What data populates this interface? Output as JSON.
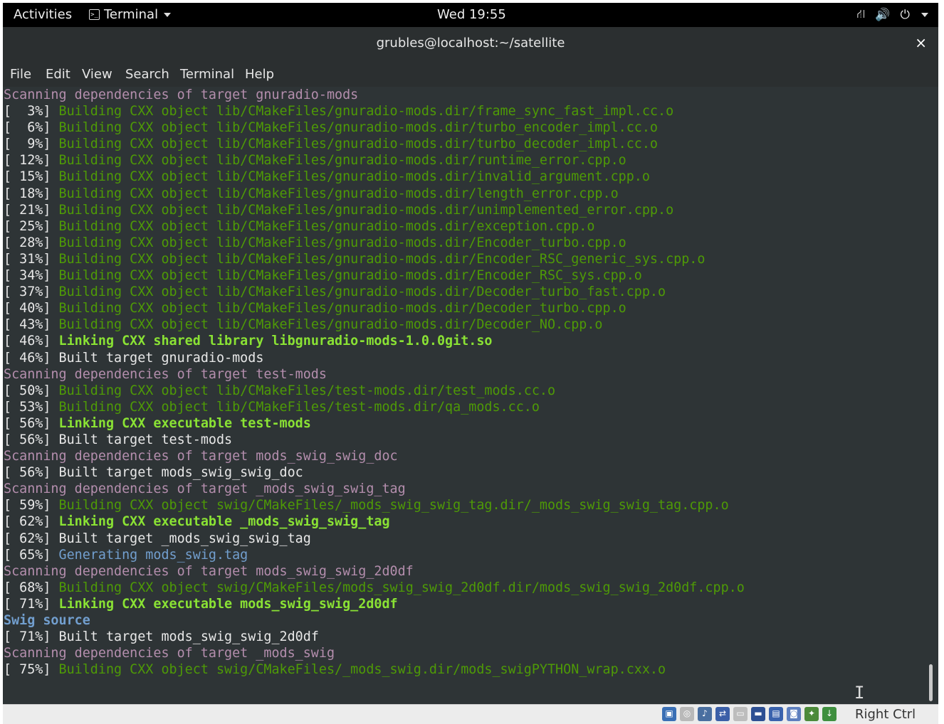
{
  "topbar": {
    "activities": "Activities",
    "app_name": "Terminal",
    "clock": "Wed 19:55"
  },
  "window": {
    "title": "grubles@localhost:~/satellite",
    "close": "×"
  },
  "menu": [
    "File",
    "Edit",
    "View",
    "Search",
    "Terminal",
    "Help"
  ],
  "terminal": {
    "lines": [
      {
        "type": "scan",
        "text": "Scanning dependencies of target gnuradio-mods"
      },
      {
        "type": "build",
        "pct": "[  3%] ",
        "text": "Building CXX object lib/CMakeFiles/gnuradio-mods.dir/frame_sync_fast_impl.cc.o"
      },
      {
        "type": "build",
        "pct": "[  6%] ",
        "text": "Building CXX object lib/CMakeFiles/gnuradio-mods.dir/turbo_encoder_impl.cc.o"
      },
      {
        "type": "build",
        "pct": "[  9%] ",
        "text": "Building CXX object lib/CMakeFiles/gnuradio-mods.dir/turbo_decoder_impl.cc.o"
      },
      {
        "type": "build",
        "pct": "[ 12%] ",
        "text": "Building CXX object lib/CMakeFiles/gnuradio-mods.dir/runtime_error.cpp.o"
      },
      {
        "type": "build",
        "pct": "[ 15%] ",
        "text": "Building CXX object lib/CMakeFiles/gnuradio-mods.dir/invalid_argument.cpp.o"
      },
      {
        "type": "build",
        "pct": "[ 18%] ",
        "text": "Building CXX object lib/CMakeFiles/gnuradio-mods.dir/length_error.cpp.o"
      },
      {
        "type": "build",
        "pct": "[ 21%] ",
        "text": "Building CXX object lib/CMakeFiles/gnuradio-mods.dir/unimplemented_error.cpp.o"
      },
      {
        "type": "build",
        "pct": "[ 25%] ",
        "text": "Building CXX object lib/CMakeFiles/gnuradio-mods.dir/exception.cpp.o"
      },
      {
        "type": "build",
        "pct": "[ 28%] ",
        "text": "Building CXX object lib/CMakeFiles/gnuradio-mods.dir/Encoder_turbo.cpp.o"
      },
      {
        "type": "build",
        "pct": "[ 31%] ",
        "text": "Building CXX object lib/CMakeFiles/gnuradio-mods.dir/Encoder_RSC_generic_sys.cpp.o"
      },
      {
        "type": "build",
        "pct": "[ 34%] ",
        "text": "Building CXX object lib/CMakeFiles/gnuradio-mods.dir/Encoder_RSC_sys.cpp.o"
      },
      {
        "type": "build",
        "pct": "[ 37%] ",
        "text": "Building CXX object lib/CMakeFiles/gnuradio-mods.dir/Decoder_turbo_fast.cpp.o"
      },
      {
        "type": "build",
        "pct": "[ 40%] ",
        "text": "Building CXX object lib/CMakeFiles/gnuradio-mods.dir/Decoder_turbo.cpp.o"
      },
      {
        "type": "build",
        "pct": "[ 43%] ",
        "text": "Building CXX object lib/CMakeFiles/gnuradio-mods.dir/Decoder_NO.cpp.o"
      },
      {
        "type": "link",
        "pct": "[ 46%] ",
        "text": "Linking CXX shared library libgnuradio-mods-1.0.0git.so"
      },
      {
        "type": "built",
        "pct": "[ 46%] ",
        "text": "Built target gnuradio-mods"
      },
      {
        "type": "scan",
        "text": "Scanning dependencies of target test-mods"
      },
      {
        "type": "build",
        "pct": "[ 50%] ",
        "text": "Building CXX object lib/CMakeFiles/test-mods.dir/test_mods.cc.o"
      },
      {
        "type": "build",
        "pct": "[ 53%] ",
        "text": "Building CXX object lib/CMakeFiles/test-mods.dir/qa_mods.cc.o"
      },
      {
        "type": "link",
        "pct": "[ 56%] ",
        "text": "Linking CXX executable test-mods"
      },
      {
        "type": "built",
        "pct": "[ 56%] ",
        "text": "Built target test-mods"
      },
      {
        "type": "scan",
        "text": "Scanning dependencies of target mods_swig_swig_doc"
      },
      {
        "type": "built",
        "pct": "[ 56%] ",
        "text": "Built target mods_swig_swig_doc"
      },
      {
        "type": "scan",
        "text": "Scanning dependencies of target _mods_swig_swig_tag"
      },
      {
        "type": "build",
        "pct": "[ 59%] ",
        "text": "Building CXX object swig/CMakeFiles/_mods_swig_swig_tag.dir/_mods_swig_swig_tag.cpp.o"
      },
      {
        "type": "link",
        "pct": "[ 62%] ",
        "text": "Linking CXX executable _mods_swig_swig_tag"
      },
      {
        "type": "built",
        "pct": "[ 62%] ",
        "text": "Built target _mods_swig_swig_tag"
      },
      {
        "type": "gen",
        "pct": "[ 65%] ",
        "text": "Generating mods_swig.tag"
      },
      {
        "type": "scan",
        "text": "Scanning dependencies of target mods_swig_swig_2d0df"
      },
      {
        "type": "build",
        "pct": "[ 68%] ",
        "text": "Building CXX object swig/CMakeFiles/mods_swig_swig_2d0df.dir/mods_swig_swig_2d0df.cpp.o"
      },
      {
        "type": "link",
        "pct": "[ 71%] ",
        "text": "Linking CXX executable mods_swig_swig_2d0df"
      },
      {
        "type": "swig",
        "text": "Swig source"
      },
      {
        "type": "built",
        "pct": "[ 71%] ",
        "text": "Built target mods_swig_swig_2d0df"
      },
      {
        "type": "scan",
        "text": "Scanning dependencies of target _mods_swig"
      },
      {
        "type": "build",
        "pct": "[ 75%] ",
        "text": "Building CXX object swig/CMakeFiles/_mods_swig.dir/mods_swigPYTHON_wrap.cxx.o"
      }
    ]
  },
  "statusbar": {
    "host_key": "Right Ctrl",
    "icons": [
      {
        "name": "hard-disk-icon",
        "color": "#3a6fb5",
        "glyph": "▣"
      },
      {
        "name": "optical-drive-icon",
        "color": "#b9b9b9",
        "glyph": "◎"
      },
      {
        "name": "audio-icon",
        "color": "#4a6fa0",
        "glyph": "♪"
      },
      {
        "name": "network-icon",
        "color": "#3b5fa8",
        "glyph": "⇄"
      },
      {
        "name": "usb-icon",
        "color": "#bdbdbd",
        "glyph": "▭"
      },
      {
        "name": "shared-folder-icon",
        "color": "#2d4f93",
        "glyph": "▬"
      },
      {
        "name": "display-icon",
        "color": "#3a62ad",
        "glyph": "▤"
      },
      {
        "name": "video-capture-icon",
        "color": "#5d7fbf",
        "glyph": "◙"
      },
      {
        "name": "mouse-integration-icon",
        "color": "#4c8a3a",
        "glyph": "✦"
      },
      {
        "name": "keyboard-capture-icon",
        "color": "#3f8f3f",
        "glyph": "↓"
      }
    ]
  }
}
